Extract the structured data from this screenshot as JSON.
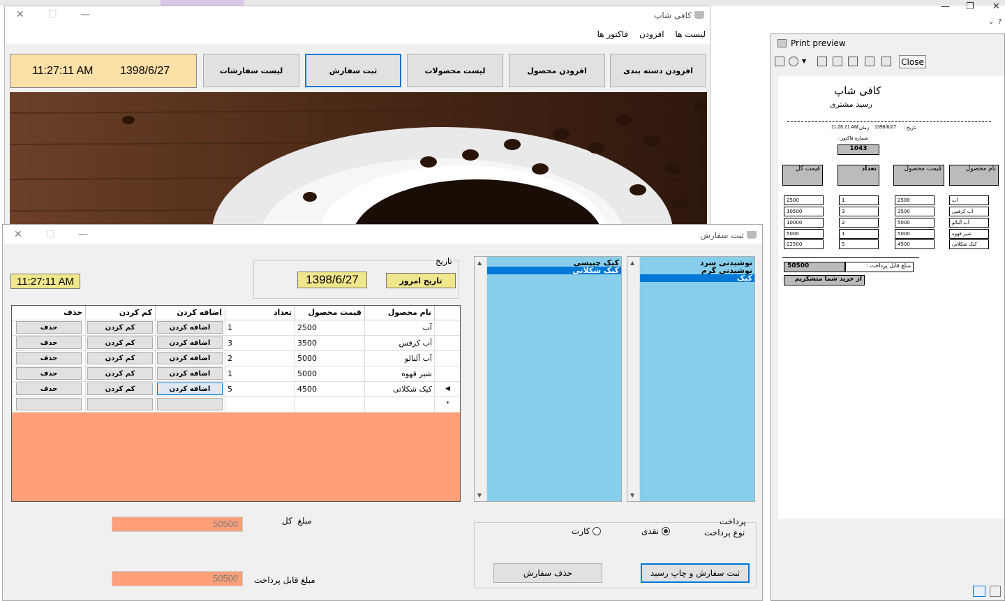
{
  "main_window": {
    "title": "کافی شاپ",
    "menu": [
      "لیست ها",
      "افزودن",
      "فاکتور ها"
    ],
    "time": "11:27:11 AM",
    "date": "1398/6/27",
    "nav_buttons": [
      "افزودن دسته بندی",
      "افزودن محصول",
      "لیست محصولات",
      "ثبت سفارش",
      "لیست سفارشات"
    ]
  },
  "order_window": {
    "title": "ثبت سفارش",
    "time": "11:27:11 AM",
    "date_group_label": "تاریخ",
    "date_value": "1398/6/27",
    "today_button": "تاریخ امروز",
    "grid": {
      "columns": [
        "نام محصول",
        "قیمت محصول",
        "تعداد",
        "اضافه کردن",
        "کم کردن",
        "حذف"
      ],
      "rows": [
        {
          "name": "آب",
          "price": "2500",
          "qty": "1"
        },
        {
          "name": "آب کرفس",
          "price": "3500",
          "qty": "3"
        },
        {
          "name": "آب آلبالو",
          "price": "5000",
          "qty": "2"
        },
        {
          "name": "شیر قهوه",
          "price": "5000",
          "qty": "1"
        },
        {
          "name": "کیک شکلاتی",
          "price": "4500",
          "qty": "5"
        }
      ],
      "add_label": "اضافه کردن",
      "minus_label": "کم کردن",
      "delete_label": "حذف",
      "new_row_marker": "*"
    },
    "categories": [
      "نوشیدنی سرد",
      "نوشیدنی گرم",
      "کیک"
    ],
    "selected_category": "کیک",
    "products": [
      "کیک چیپسی",
      "کیک شکلاتی"
    ],
    "selected_product": "کیک شکلاتی",
    "total_label": "مبلغ  کل",
    "total_value": "50500",
    "payable_label": "مبلغ قابل پرداخت",
    "payable_value": "50500",
    "payment_group_label": "پرداخت",
    "payment_type_label": "نوع پرداخت",
    "payment_options": [
      "نقدی",
      "کارت"
    ],
    "payment_selected": "نقدی",
    "submit_button": "ثبت سفارش و چاپ رسید",
    "delete_order_button": "حذف سفارش"
  },
  "print_preview": {
    "title": "Print preview",
    "close_button": "Close",
    "receipt": {
      "shop_name": "کافی شاپ",
      "subtitle": "رسید مشتری",
      "date_label": "تاریخ :",
      "date": "1398/6/27",
      "time_label": "زمان :",
      "time": "11:26:21 AM",
      "invoice_label": "شماره فاکتور :",
      "invoice_no": "1043",
      "headers": [
        "نام محصول",
        "قیمت محصول",
        "تعداد",
        "قیمت کل"
      ],
      "names": [
        "آب",
        "آب کرفس",
        "آب آلبالو",
        "شیر قهوه",
        "کیک شکلاتی"
      ],
      "prices": [
        "2500",
        "3500",
        "5000",
        "5000",
        "4500"
      ],
      "qtys": [
        "1",
        "3",
        "2",
        "1",
        "5"
      ],
      "totals": [
        "2500",
        "10500",
        "10000",
        "5000",
        "22500"
      ],
      "payable_label": "مبلغ قابل پرداخت :",
      "payable_value": "50500",
      "thanks": "از خرید شما متشکریم"
    }
  },
  "colors": {
    "accent": "#0078d7",
    "listbox": "#87ceeb",
    "salmon": "#ffa07a",
    "khaki": "#f0e68c",
    "time_panel": "#fde0a8"
  }
}
